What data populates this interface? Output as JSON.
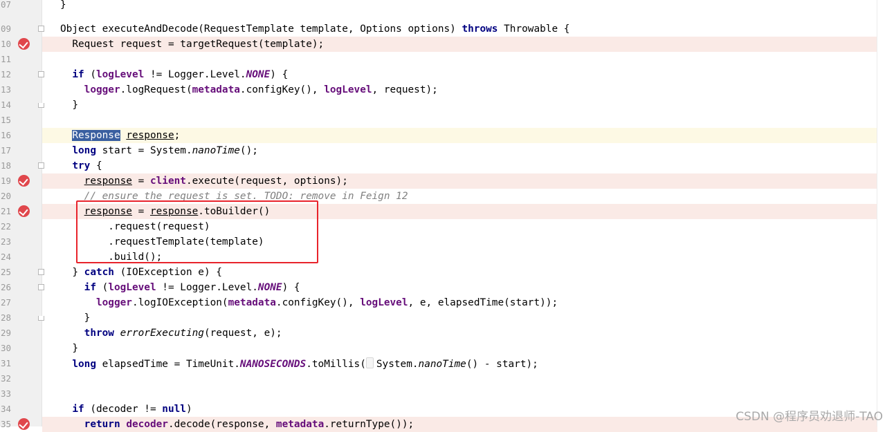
{
  "editor": {
    "lines": [
      {
        "num": "09",
        "tokens": [
          [
            "t",
            "Object executeAndDecode(RequestTemplate template, Options options) "
          ],
          [
            "kw",
            "throws"
          ],
          [
            "t",
            " Throwable {"
          ]
        ]
      },
      {
        "num": "10",
        "tokens": [
          [
            "t",
            "  Request request = targetRequest(template);"
          ]
        ]
      },
      {
        "num": "11",
        "tokens": []
      },
      {
        "num": "12",
        "tokens": [
          [
            "t",
            "  "
          ],
          [
            "kw",
            "if"
          ],
          [
            "t",
            " ("
          ],
          [
            "fld",
            "logLevel"
          ],
          [
            "t",
            " != Logger.Level."
          ],
          [
            "const",
            "NONE"
          ],
          [
            "t",
            ") {"
          ]
        ]
      },
      {
        "num": "13",
        "tokens": [
          [
            "t",
            "    "
          ],
          [
            "fld",
            "logger"
          ],
          [
            "t",
            ".logRequest("
          ],
          [
            "fld",
            "metadata"
          ],
          [
            "t",
            ".configKey(), "
          ],
          [
            "fld",
            "logLevel"
          ],
          [
            "t",
            ", request);"
          ]
        ]
      },
      {
        "num": "14",
        "tokens": [
          [
            "t",
            "  }"
          ]
        ]
      },
      {
        "num": "15",
        "tokens": []
      },
      {
        "num": "16",
        "tokens": [
          [
            "t",
            "  "
          ],
          [
            "sel",
            "Response"
          ],
          [
            "t",
            " "
          ],
          [
            "ul",
            "response"
          ],
          [
            "t",
            ";"
          ]
        ]
      },
      {
        "num": "17",
        "tokens": [
          [
            "t",
            "  "
          ],
          [
            "kw",
            "long"
          ],
          [
            "t",
            " start = System."
          ],
          [
            "stat",
            "nanoTime"
          ],
          [
            "t",
            "();"
          ]
        ]
      },
      {
        "num": "18",
        "tokens": [
          [
            "t",
            "  "
          ],
          [
            "kw",
            "try"
          ],
          [
            "t",
            " {"
          ]
        ]
      },
      {
        "num": "19",
        "tokens": [
          [
            "t",
            "    "
          ],
          [
            "ul",
            "response"
          ],
          [
            "t",
            " = "
          ],
          [
            "fld",
            "client"
          ],
          [
            "t",
            ".execute(request, options);"
          ]
        ]
      },
      {
        "num": "20",
        "tokens": [
          [
            "cmt",
            "    // ensure the request is set. TODO: remove in Feign 12"
          ]
        ]
      },
      {
        "num": "21",
        "tokens": [
          [
            "t",
            "    "
          ],
          [
            "ul",
            "response"
          ],
          [
            "t",
            " = "
          ],
          [
            "ul",
            "response"
          ],
          [
            "t",
            ".toBuilder()"
          ]
        ]
      },
      {
        "num": "22",
        "tokens": [
          [
            "t",
            "        .request(request)"
          ]
        ]
      },
      {
        "num": "23",
        "tokens": [
          [
            "t",
            "        .requestTemplate(template)"
          ]
        ]
      },
      {
        "num": "24",
        "tokens": [
          [
            "t",
            "        .build();"
          ]
        ]
      },
      {
        "num": "25",
        "tokens": [
          [
            "t",
            "  } "
          ],
          [
            "kw",
            "catch"
          ],
          [
            "t",
            " (IOException e) {"
          ]
        ]
      },
      {
        "num": "26",
        "tokens": [
          [
            "t",
            "    "
          ],
          [
            "kw",
            "if"
          ],
          [
            "t",
            " ("
          ],
          [
            "fld",
            "logLevel"
          ],
          [
            "t",
            " != Logger.Level."
          ],
          [
            "const",
            "NONE"
          ],
          [
            "t",
            ") {"
          ]
        ]
      },
      {
        "num": "27",
        "tokens": [
          [
            "t",
            "      "
          ],
          [
            "fld",
            "logger"
          ],
          [
            "t",
            ".logIOException("
          ],
          [
            "fld",
            "metadata"
          ],
          [
            "t",
            ".configKey(), "
          ],
          [
            "fld",
            "logLevel"
          ],
          [
            "t",
            ", e, elapsedTime(start));"
          ]
        ]
      },
      {
        "num": "28",
        "tokens": [
          [
            "t",
            "    }"
          ]
        ]
      },
      {
        "num": "29",
        "tokens": [
          [
            "t",
            "    "
          ],
          [
            "kw",
            "throw"
          ],
          [
            "t",
            " "
          ],
          [
            "stat",
            "errorExecuting"
          ],
          [
            "t",
            "(request, e);"
          ]
        ]
      },
      {
        "num": "30",
        "tokens": [
          [
            "t",
            "  }"
          ]
        ]
      },
      {
        "num": "31",
        "tokens": [
          [
            "t",
            "  "
          ],
          [
            "kw",
            "long"
          ],
          [
            "t",
            " elapsedTime = TimeUnit."
          ],
          [
            "const",
            "NANOSECONDS"
          ],
          [
            "t",
            ".toMillis("
          ],
          [
            "hint",
            ""
          ],
          [
            "t",
            "System."
          ],
          [
            "stat",
            "nanoTime"
          ],
          [
            "t",
            "() - start);"
          ]
        ]
      },
      {
        "num": "32",
        "tokens": []
      },
      {
        "num": "33",
        "tokens": []
      },
      {
        "num": "34",
        "tokens": [
          [
            "t",
            "  "
          ],
          [
            "kw",
            "if"
          ],
          [
            "t",
            " (decoder != "
          ],
          [
            "kw",
            "null"
          ],
          [
            "t",
            ")"
          ]
        ]
      },
      {
        "num": "35",
        "tokens": [
          [
            "t",
            "    "
          ],
          [
            "kw",
            "return"
          ],
          [
            "t",
            " "
          ],
          [
            "fld",
            "decoder"
          ],
          [
            "t",
            ".decode(response, "
          ],
          [
            "fld",
            "metadata"
          ],
          [
            "t",
            ".returnType());"
          ]
        ]
      }
    ],
    "breakpoint_lines": [
      "10",
      "19",
      "21",
      "35"
    ],
    "current_line": "16",
    "fold_start_lines": [
      "09",
      "12",
      "18",
      "25",
      "26"
    ],
    "fold_end_lines": [
      "14",
      "28"
    ],
    "top_partial_line": {
      "num": "07",
      "text": "}"
    }
  },
  "watermark": "CSDN @程序员劝退师-TAO",
  "colors": {
    "keyword": "#000080",
    "field": "#660e7a",
    "comment": "#808080",
    "breakpoint": "#e0474c",
    "breakpoint_line_bg": "#faeae6",
    "selection": "#3a5fa0",
    "annotation_box": "#e8232b"
  }
}
